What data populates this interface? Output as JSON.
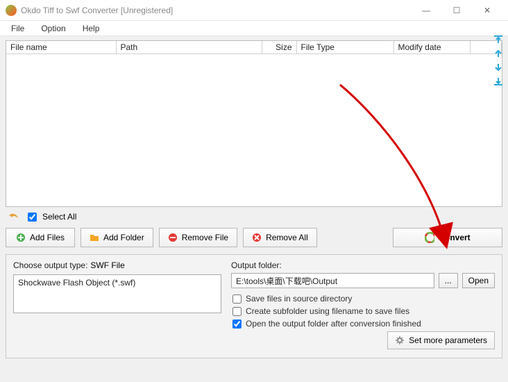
{
  "window": {
    "title": "Okdo Tiff to Swf Converter [Unregistered]",
    "min": "—",
    "max": "☐",
    "close": "✕"
  },
  "menu": {
    "file": "File",
    "option": "Option",
    "help": "Help"
  },
  "columns": {
    "name": "File name",
    "path": "Path",
    "size": "Size",
    "type": "File Type",
    "modify": "Modify date"
  },
  "selectall": {
    "label": "Select All"
  },
  "toolbar": {
    "add_files": "Add Files",
    "add_folder": "Add Folder",
    "remove_file": "Remove File",
    "remove_all": "Remove All",
    "convert": "Convert"
  },
  "output": {
    "choose_type_label": "Choose output type:",
    "swf_file": "SWF File",
    "type_selected": "Shockwave Flash Object (*.swf)",
    "folder_label": "Output folder:",
    "folder_value": "E:\\tools\\桌面\\下载吧\\Output",
    "browse": "...",
    "open": "Open",
    "save_source": "Save files in source directory",
    "create_subfolder": "Create subfolder using filename to save files",
    "open_after": "Open the output folder after conversion finished",
    "set_more": "Set more parameters"
  }
}
